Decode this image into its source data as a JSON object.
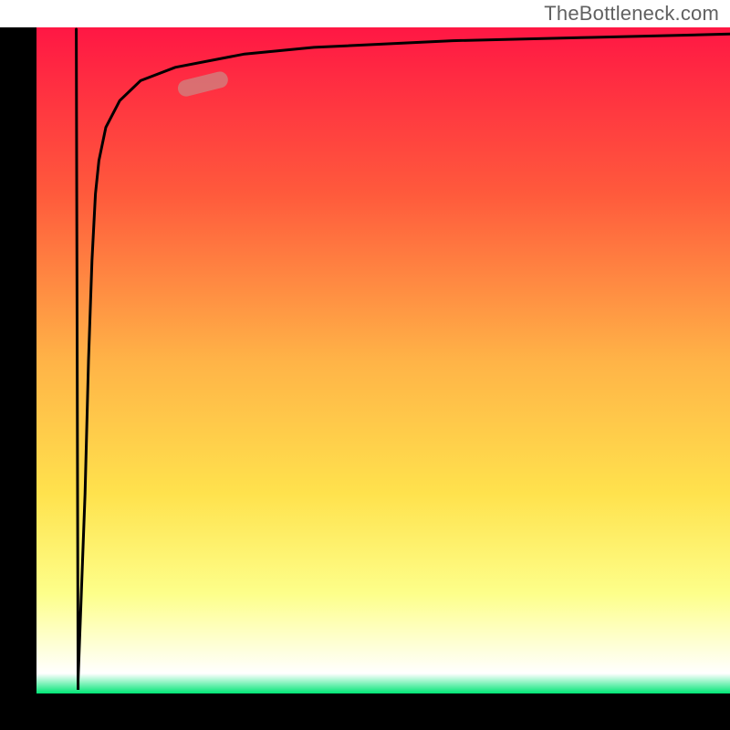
{
  "attribution": "TheBottleneck.com",
  "chart_data": {
    "type": "line",
    "title": "",
    "xlabel": "",
    "ylabel": "",
    "xlim": [
      0,
      100
    ],
    "ylim": [
      0,
      100
    ],
    "grid": false,
    "legend": false,
    "background_gradient": {
      "stops": [
        {
          "pct": 0,
          "color": "#ff1744"
        },
        {
          "pct": 25,
          "color": "#ff5a3c"
        },
        {
          "pct": 50,
          "color": "#ffb347"
        },
        {
          "pct": 70,
          "color": "#ffe24d"
        },
        {
          "pct": 85,
          "color": "#fdff8a"
        },
        {
          "pct": 97,
          "color": "#ffffff"
        },
        {
          "pct": 100,
          "color": "#00e676"
        }
      ]
    },
    "series": [
      {
        "name": "curve",
        "color": "#000000",
        "x": [
          6,
          7,
          7.5,
          8,
          8.5,
          9,
          10,
          12,
          15,
          20,
          30,
          40,
          60,
          80,
          100
        ],
        "y": [
          2,
          30,
          50,
          65,
          75,
          80,
          85,
          89,
          92,
          94,
          96,
          97,
          98,
          98.5,
          99
        ]
      }
    ],
    "highlight_segment": {
      "color": "#d47a7a",
      "x_range": [
        20,
        28
      ],
      "y_range": [
        90.5,
        92.5
      ]
    },
    "axis_thickness_px": 40
  }
}
